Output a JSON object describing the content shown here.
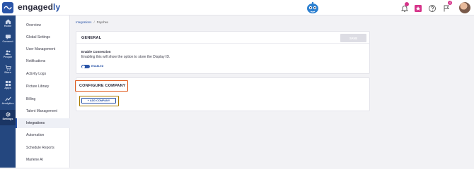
{
  "app": {
    "logo_text_a": "engaged",
    "logo_text_b": "ly",
    "notifications_badge": "4",
    "brand_color": "#2b55a8",
    "accent_color": "#e05a1d"
  },
  "rail": {
    "items": [
      {
        "label": "Home",
        "icon": "home-icon"
      },
      {
        "label": "Connect",
        "icon": "chat-icon"
      },
      {
        "label": "People",
        "icon": "people-icon"
      },
      {
        "label": "Store",
        "icon": "cart-icon"
      },
      {
        "label": "Apps",
        "icon": "apps-icon"
      },
      {
        "label": "Analytics",
        "icon": "analytics-icon"
      },
      {
        "label": "Settings",
        "icon": "gear-icon"
      }
    ]
  },
  "subnav": {
    "items": [
      "Overview",
      "Global Settings",
      "User Management",
      "Notifications",
      "Activity Logs",
      "Picture Library",
      "Billing",
      "Talent Management",
      "Integrations",
      "Automation",
      "Schedule Reports",
      "Marlene AI"
    ],
    "active": "Integrations"
  },
  "breadcrumb": {
    "root": "Integrations",
    "current": "Paychex"
  },
  "general": {
    "title": "GENERAL",
    "save_label": "SAVE",
    "enable_title": "Enable Connection",
    "enable_desc": "Enabling this will show the option to store the Display ID.",
    "toggle_label": "ENABLED",
    "toggle_on": true
  },
  "configure": {
    "title": "CONFIGURE COMPANY",
    "add_label": "+ ADD COMPANY"
  }
}
